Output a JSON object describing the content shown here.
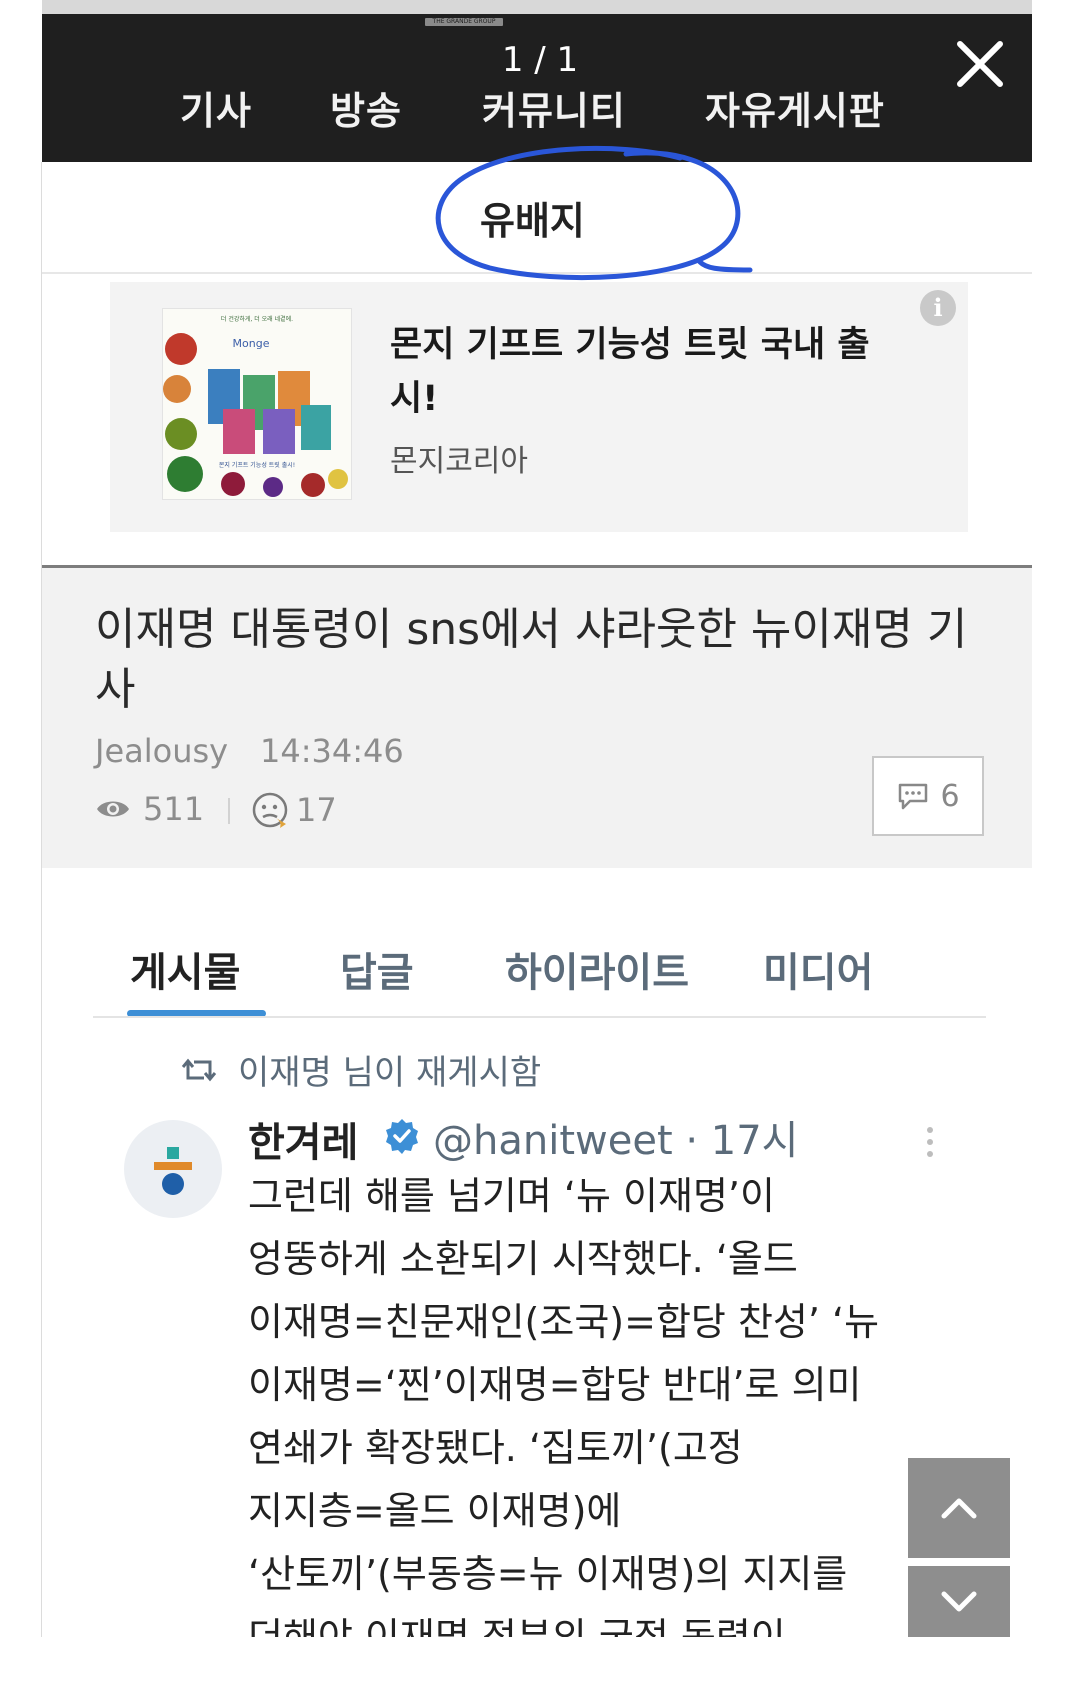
{
  "viewer": {
    "brand": "THE GRANDE GROUP",
    "page_counter": "1 / 1",
    "nav": [
      "기사",
      "방송",
      "커뮤니티",
      "자유게시판"
    ]
  },
  "board": {
    "title": "유배지"
  },
  "ad": {
    "title": "몬지 기프트 기능성 트릿 국내 출시!",
    "sponsor": "몬지코리아",
    "image_text": [
      "더 건강하게, 더 오래 네곁에.",
      "Monge",
      "몬지 기프트 기능성 트릿 출시!"
    ],
    "info_icon": "i"
  },
  "post": {
    "title": "이재명 대통령이 sns에서 샤라웃한 뉴이재명 기사",
    "author": "Jealousy",
    "time": "14:34:46",
    "views": "511",
    "likes": "17",
    "comments": "6"
  },
  "tweet": {
    "tabs": [
      "게시물",
      "답글",
      "하이라이트",
      "미디어"
    ],
    "retweet_text": "이재명 님이 재게시함",
    "name": "한겨레",
    "handle_time": "@hanitweet · 17시",
    "body": "그런데 해를 넘기며 ‘뉴 이재명’이\n엉뚱하게 소환되기 시작했다. ‘올드\n이재명=친문재인(조국)=합당 찬성’ ‘뉴\n이재명=‘찐’이재명=합당 반대’로 의미\n연쇄가 확장됐다. ‘집토끼’(고정\n지지층=올드 이재명)에\n‘산토끼’(부동층=뉴 이재명)의 지지를\n더해야 이재명 정부의 국정 동력이"
  },
  "colors": {
    "viewer_bg": "#1f1f1f",
    "annotation": "#2a56d8",
    "twitter_blue": "#3d8fd6",
    "muted": "#8d8d8d"
  },
  "icons": [
    "close-icon",
    "info-icon",
    "eye-icon",
    "like-emoji-icon",
    "comment-icon",
    "retweet-icon",
    "verified-badge-icon",
    "more-icon",
    "chevron-up-icon",
    "chevron-down-icon"
  ]
}
